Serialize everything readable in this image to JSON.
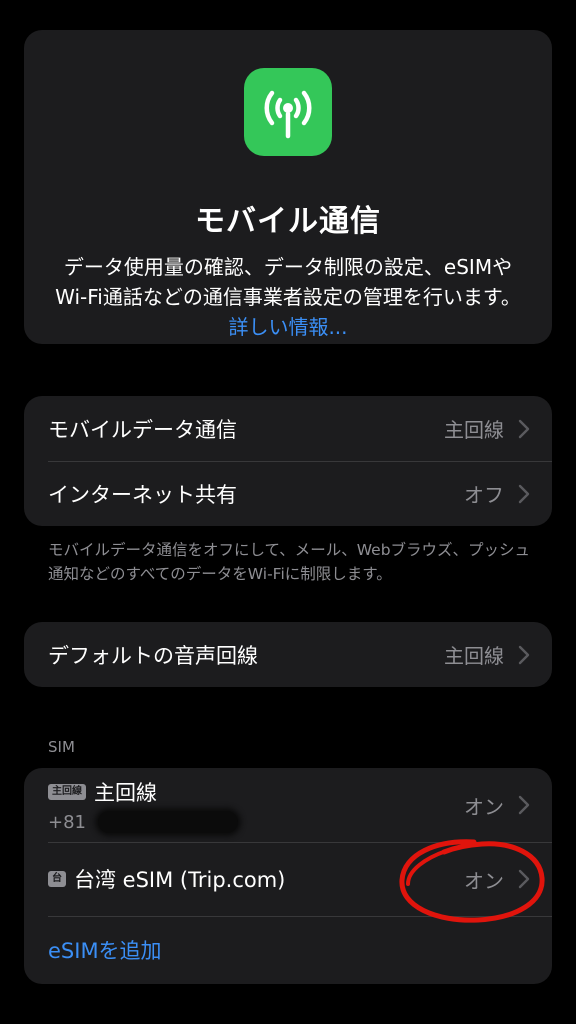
{
  "hero": {
    "title": "モバイル通信",
    "description": "データ使用量の確認、データ制限の設定、eSIMやWi-Fi通話などの通信事業者設定の管理を行います。",
    "link": "詳しい情報..."
  },
  "group1": {
    "rows": [
      {
        "label": "モバイルデータ通信",
        "value": "主回線"
      },
      {
        "label": "インターネット共有",
        "value": "オフ"
      }
    ],
    "footnote": "モバイルデータ通信をオフにして、メール、Webブラウズ、プッシュ通知などのすべてのデータをWi-Fiに制限します。"
  },
  "group2": {
    "rows": [
      {
        "label": "デフォルトの音声回線",
        "value": "主回線"
      }
    ]
  },
  "sim": {
    "header": "SIM",
    "lines": [
      {
        "badge": "主回線",
        "name": "主回線",
        "number": "+81",
        "status": "オン"
      },
      {
        "badge": "台",
        "name": "台湾 eSIM (Trip.com)",
        "status": "オン"
      }
    ],
    "add_label": "eSIMを追加"
  },
  "colors": {
    "background": "#000000",
    "card": "#1c1c1e",
    "accent": "#3b8ff6",
    "icon_green": "#34c759",
    "secondary_text": "#8e8e93",
    "annotation_red": "#e0140c"
  },
  "icons": {
    "hero": "antenna-signal-icon",
    "chevron": "chevron-right-icon"
  }
}
